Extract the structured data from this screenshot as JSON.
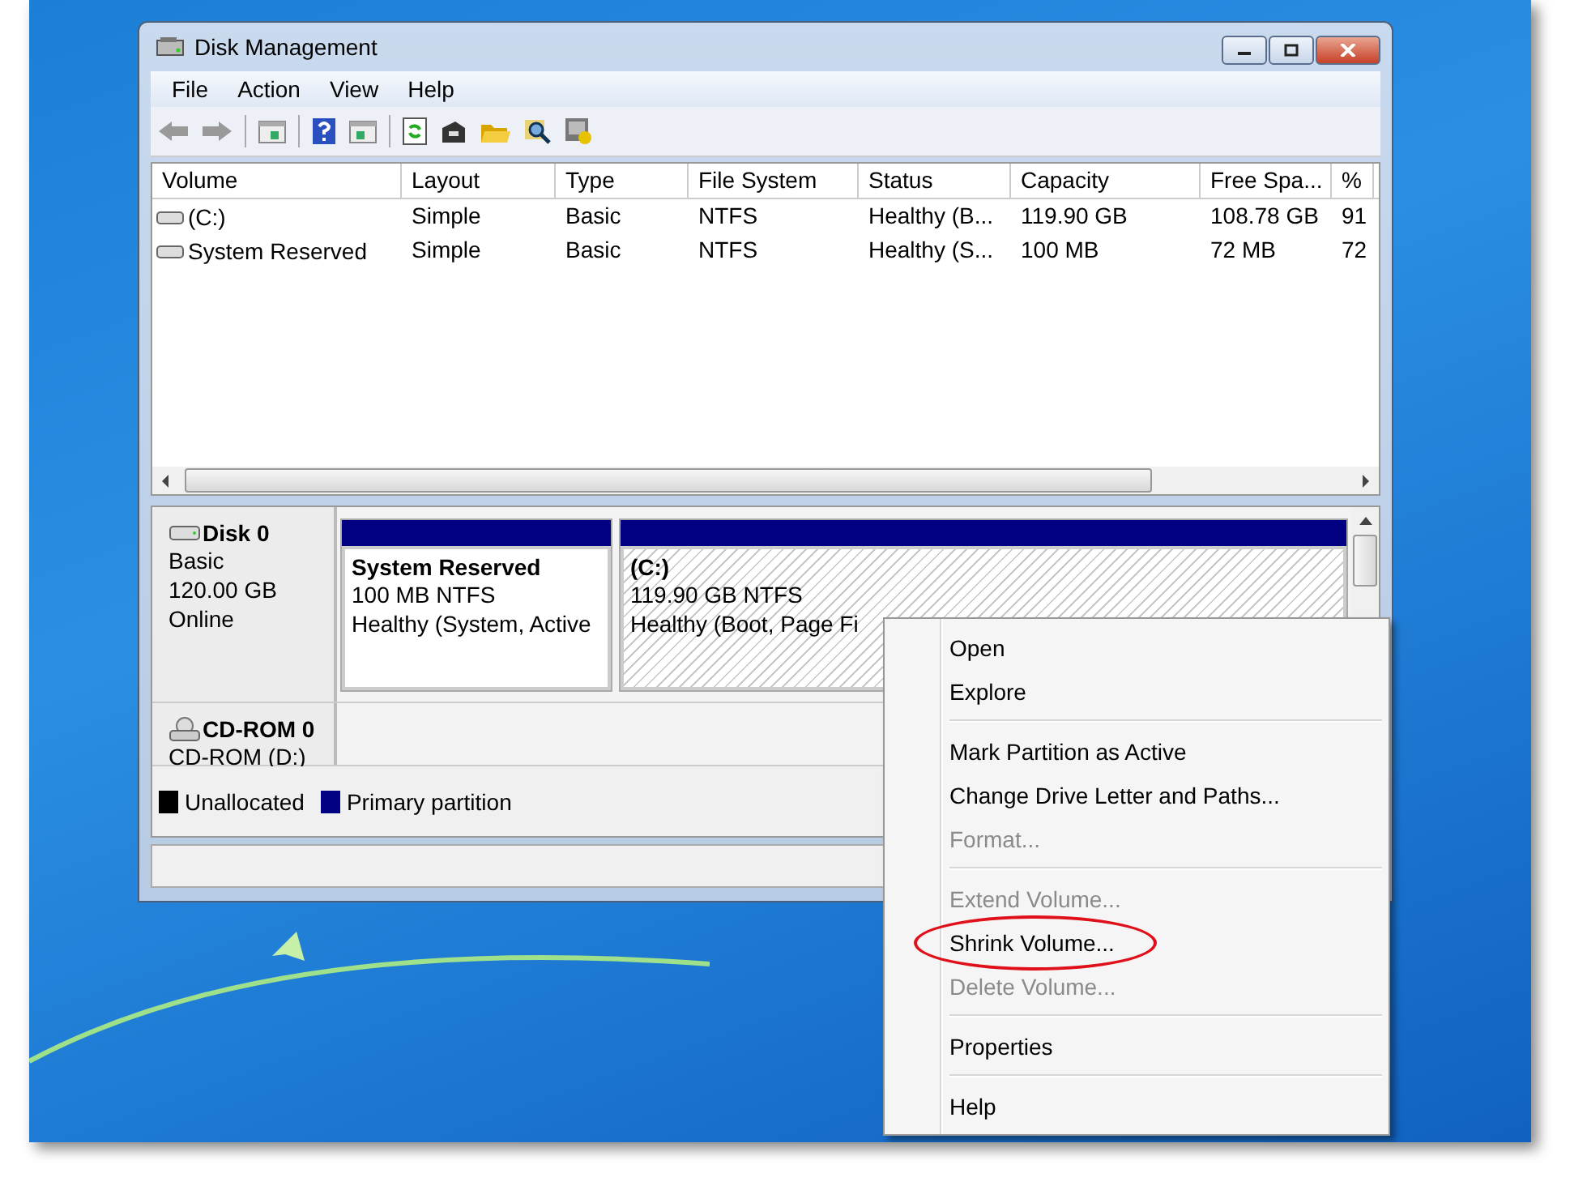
{
  "window": {
    "title": "Disk Management"
  },
  "menu_bar": [
    "File",
    "Action",
    "View",
    "Help"
  ],
  "volume_table": {
    "columns": [
      "Volume",
      "Layout",
      "Type",
      "File System",
      "Status",
      "Capacity",
      "Free Spa...",
      "%"
    ],
    "rows": [
      [
        "(C:)",
        "Simple",
        "Basic",
        "NTFS",
        "Healthy (B...",
        "119.90 GB",
        "108.78 GB",
        "91"
      ],
      [
        "System Reserved",
        "Simple",
        "Basic",
        "NTFS",
        "Healthy (S...",
        "100 MB",
        "72 MB",
        "72"
      ]
    ]
  },
  "disks": [
    {
      "kind": "disk",
      "name": "Disk 0",
      "lines": [
        "Basic",
        "120.00 GB",
        "Online"
      ],
      "partitions": [
        {
          "name": "System Reserved",
          "size": "100 MB NTFS",
          "status": "Healthy (System, Active",
          "hatched": false
        },
        {
          "name": "(C:)",
          "size": "119.90 GB NTFS",
          "status": "Healthy (Boot, Page Fi",
          "hatched": true
        }
      ]
    },
    {
      "kind": "cdrom",
      "name": "CD-ROM 0",
      "lines": [
        "CD-ROM (D:)"
      ]
    }
  ],
  "legend": [
    {
      "label": "Unallocated",
      "color": "#000000"
    },
    {
      "label": "Primary partition",
      "color": "#000080"
    }
  ],
  "context_menu": [
    {
      "kind": "item",
      "label": "Open",
      "disabled": false,
      "circled": false
    },
    {
      "kind": "item",
      "label": "Explore",
      "disabled": false,
      "circled": false
    },
    {
      "kind": "separator"
    },
    {
      "kind": "item",
      "label": "Mark Partition as Active",
      "disabled": false,
      "circled": false
    },
    {
      "kind": "item",
      "label": "Change Drive Letter and Paths...",
      "disabled": false,
      "circled": false
    },
    {
      "kind": "item",
      "label": "Format...",
      "disabled": true,
      "circled": false
    },
    {
      "kind": "separator"
    },
    {
      "kind": "item",
      "label": "Extend Volume...",
      "disabled": true,
      "circled": false
    },
    {
      "kind": "item",
      "label": "Shrink Volume...",
      "disabled": false,
      "circled": true
    },
    {
      "kind": "item",
      "label": "Delete Volume...",
      "disabled": true,
      "circled": false
    },
    {
      "kind": "separator"
    },
    {
      "kind": "item",
      "label": "Properties",
      "disabled": false,
      "circled": false
    },
    {
      "kind": "separator"
    },
    {
      "kind": "item",
      "label": "Help",
      "disabled": false,
      "circled": false
    }
  ]
}
